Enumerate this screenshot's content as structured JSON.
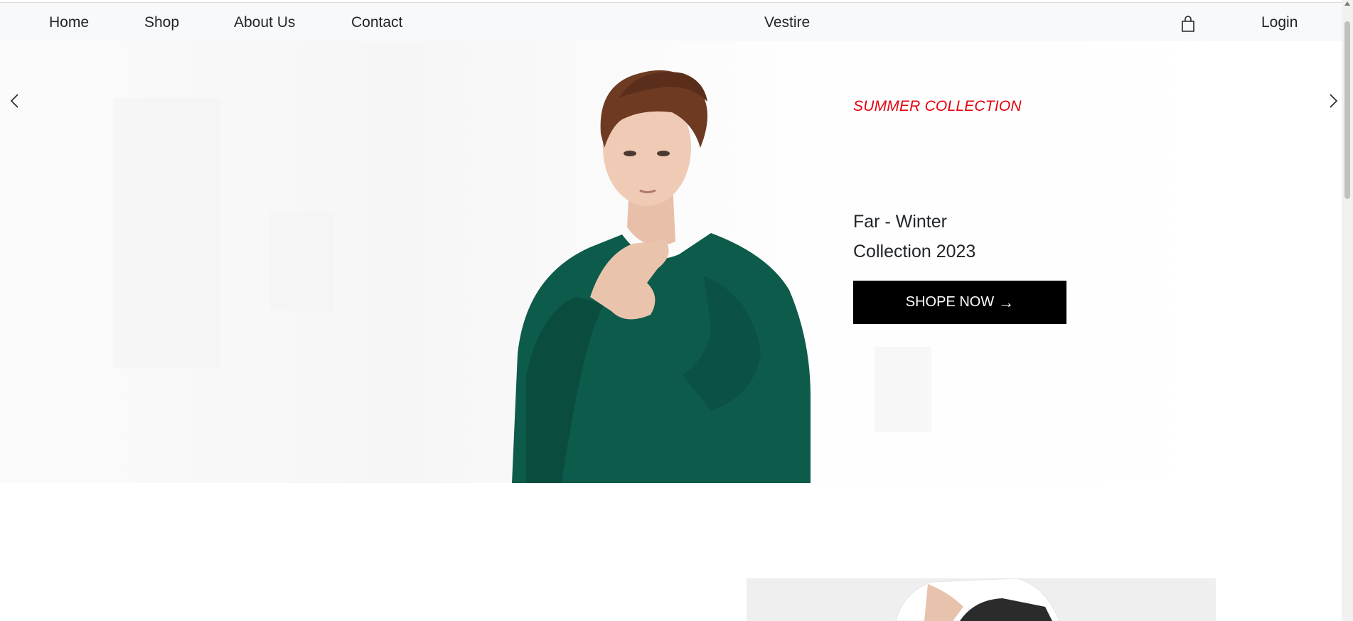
{
  "nav": {
    "links": [
      {
        "label": "Home"
      },
      {
        "label": "Shop"
      },
      {
        "label": "About Us"
      },
      {
        "label": "Contact"
      }
    ],
    "brand": "Vestire",
    "cart_icon": "shopping-bag-icon",
    "login_label": "Login"
  },
  "hero": {
    "subtitle": "SUMMER COLLECTION",
    "title_line1": "Far - Winter",
    "title_line2": "Collection 2023",
    "button_label": "SHOPE NOW",
    "button_icon": "arrow-right-icon",
    "prev_icon": "chevron-left-icon",
    "next_icon": "chevron-right-icon"
  },
  "colors": {
    "accent": "#e3000f",
    "button_bg": "#000000",
    "navbar_bg": "#f8f9fa",
    "sweater": "#0d5b4b"
  }
}
